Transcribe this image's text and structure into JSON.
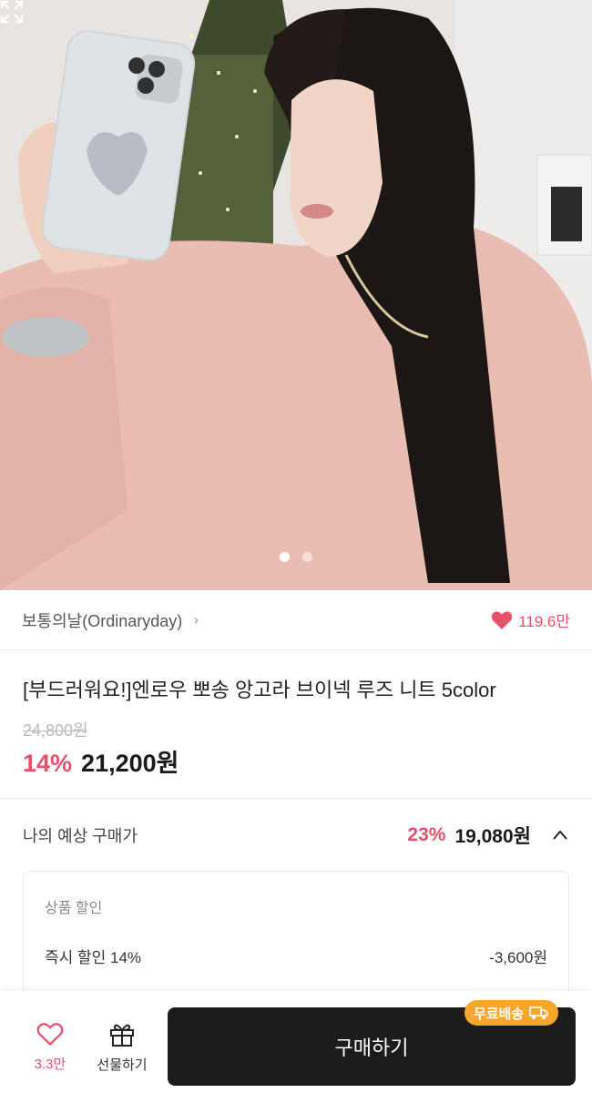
{
  "product": {
    "brand": "보통의날(Ordinaryday)",
    "like_count": "119.6만",
    "title": "[부드러워요!]엔로우 뽀송 앙고라 브이넥 루즈 니트 5color",
    "original_price": "24,800원",
    "discount_rate": "14%",
    "sale_price": "21,200원"
  },
  "expected": {
    "label": "나의 예상 구매가",
    "rate": "23%",
    "price": "19,080원"
  },
  "breakdown": {
    "section_title": "상품 할인",
    "items": [
      {
        "label": "즉시 할인 14%",
        "amount": "-3,600원"
      }
    ]
  },
  "gallery": {
    "current_page": 1,
    "total_pages": 2
  },
  "bottom_bar": {
    "wish_count": "3.3만",
    "gift_label": "선물하기",
    "buy_label": "구매하기",
    "shipping_badge": "무료배송"
  },
  "colors": {
    "accent": "#e5506b",
    "buy_button": "#1c1c1c",
    "shipping_badge": "#f7a62b"
  },
  "icons": {
    "expand": "expand-icon",
    "heart": "heart-icon",
    "gift": "gift-icon",
    "chevron_up": "chevron-up-icon",
    "truck": "truck-icon"
  }
}
